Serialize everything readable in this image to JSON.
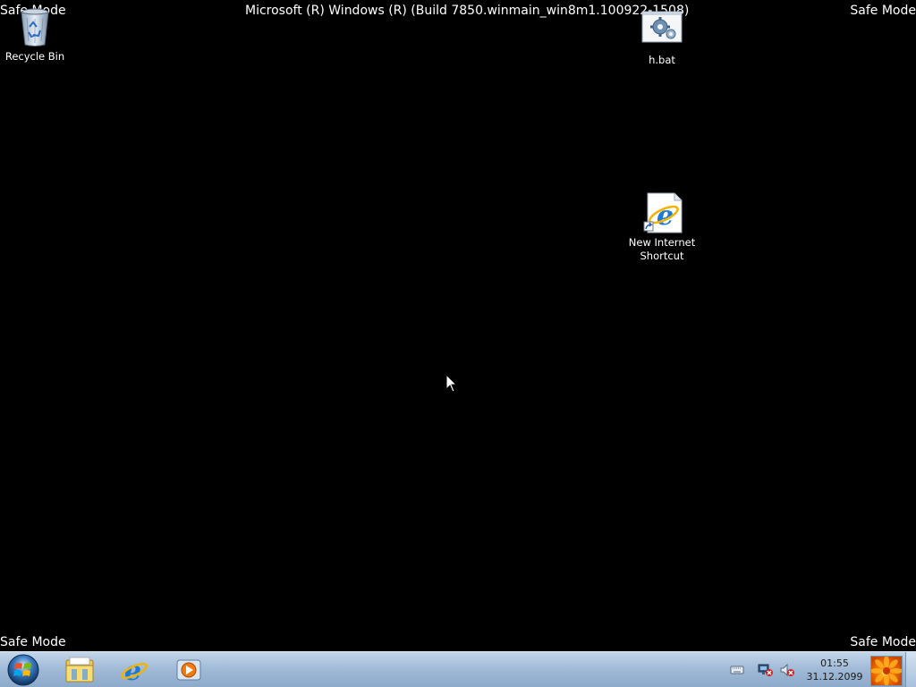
{
  "overlay": {
    "safe_mode_top_left": "Safe Mode",
    "safe_mode_top_right": "Safe Mode",
    "safe_mode_bottom_left": "Safe Mode",
    "safe_mode_bottom_right": "Safe Mode",
    "build_string": "Microsoft (R) Windows (R) (Build 7850.winmain_win8m1.100922-1508)"
  },
  "desktop_icons": [
    {
      "label": "Recycle Bin",
      "icon": "recycle-bin-icon"
    },
    {
      "label": "h.bat",
      "icon": "batch-file-icon"
    },
    {
      "label": "New Internet Shortcut",
      "icon": "internet-shortcut-icon"
    }
  ],
  "taskbar": {
    "start": {
      "icon": "windows-start-orb-icon"
    },
    "pinned": [
      {
        "name": "Windows Explorer",
        "icon": "folder-explorer-icon"
      },
      {
        "name": "Internet Explorer",
        "icon": "internet-explorer-icon"
      },
      {
        "name": "Windows Media Player",
        "icon": "media-player-icon"
      }
    ],
    "tray": {
      "icons": [
        "keyboard-icon",
        "network-icon",
        "volume-muted-icon"
      ],
      "time": "01:55",
      "date": "31.12.2099"
    }
  },
  "colors": {
    "desktop_background": "#000000",
    "taskbar": "#a9c1dc",
    "overlay_text": "#ffffff"
  }
}
